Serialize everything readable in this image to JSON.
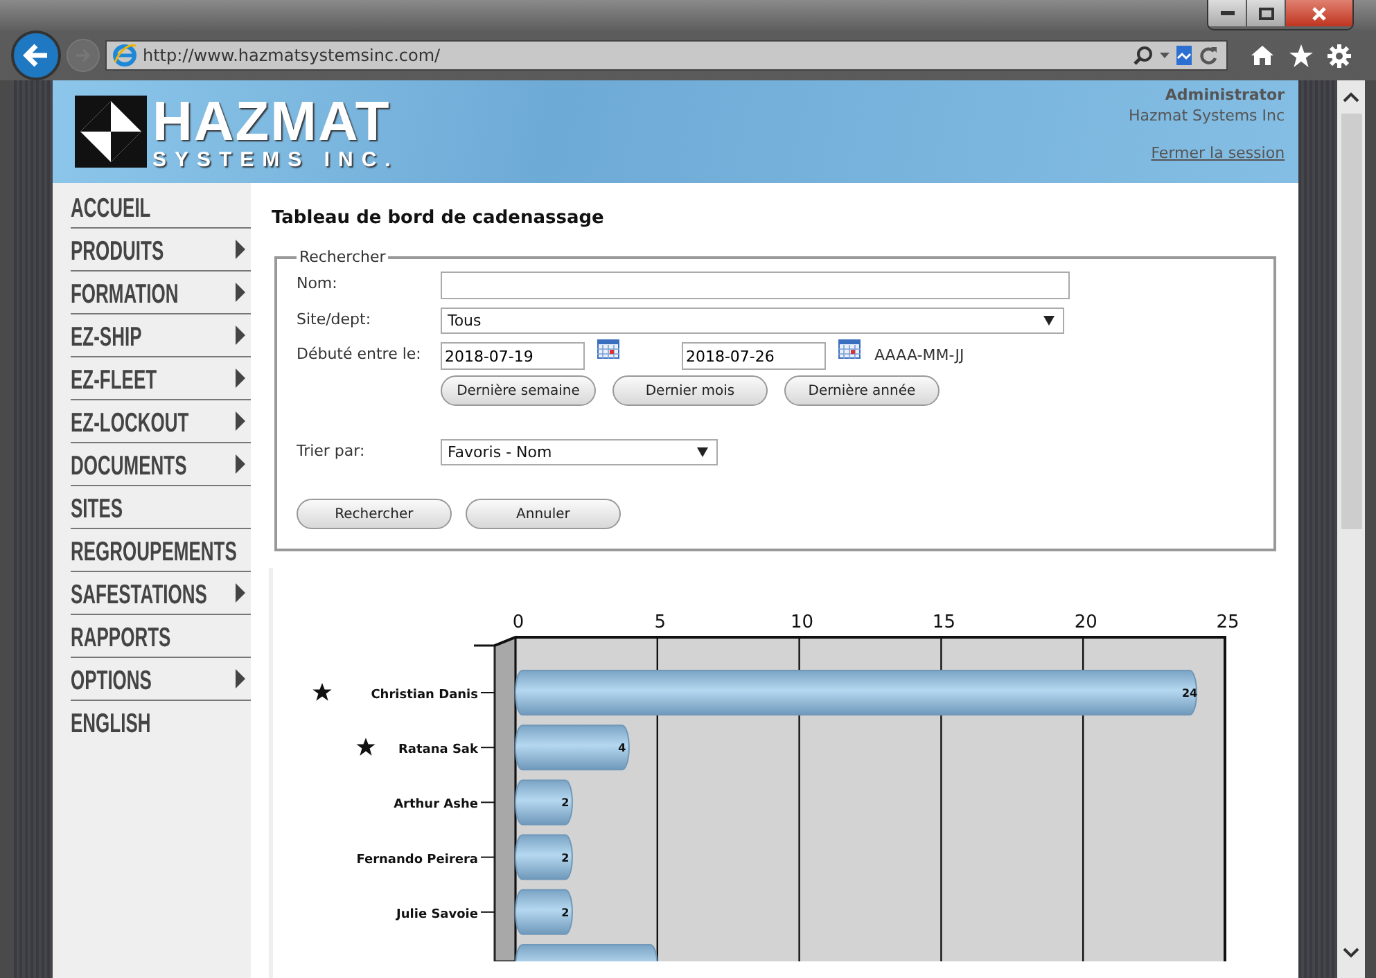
{
  "browser": {
    "url": "http://www.hazmatsystemsinc.com/"
  },
  "header": {
    "logo_top": "HAZMAT",
    "logo_bottom": "SYSTEMS INC.",
    "user": "Administrator",
    "company": "Hazmat Systems Inc",
    "logout": "Fermer la session"
  },
  "nav": [
    {
      "label": "ACCUEIL",
      "has_submenu": false
    },
    {
      "label": "PRODUITS",
      "has_submenu": true
    },
    {
      "label": "FORMATION",
      "has_submenu": true
    },
    {
      "label": "EZ-SHIP",
      "has_submenu": true
    },
    {
      "label": "EZ-FLEET",
      "has_submenu": true
    },
    {
      "label": "EZ-LOCKOUT",
      "has_submenu": true
    },
    {
      "label": "DOCUMENTS",
      "has_submenu": true
    },
    {
      "label": "SITES",
      "has_submenu": false
    },
    {
      "label": "REGROUPEMENTS",
      "has_submenu": false
    },
    {
      "label": "SAFESTATIONS",
      "has_submenu": true
    },
    {
      "label": "RAPPORTS",
      "has_submenu": false
    },
    {
      "label": "OPTIONS",
      "has_submenu": true
    },
    {
      "label": "ENGLISH",
      "has_submenu": false
    }
  ],
  "page_title": "Tableau de bord de cadenassage",
  "search_form": {
    "legend": "Rechercher",
    "name_label": "Nom:",
    "site_label": "Site/dept:",
    "site_value": "Tous",
    "date_label": "Débuté entre le:",
    "date_from": "2018-07-19",
    "date_to": "2018-07-26",
    "date_format": "AAAA-MM-JJ",
    "quick_ranges": [
      "Dernière semaine",
      "Dernier mois",
      "Dernière année"
    ],
    "sort_label": "Trier par:",
    "sort_value": "Favoris - Nom",
    "buttons": [
      "Rechercher",
      "Annuler"
    ]
  },
  "chart": {
    "favorites": [
      true,
      true,
      false,
      false,
      false
    ],
    "chart_data": {
      "type": "bar",
      "orientation": "horizontal",
      "categories": [
        "Christian Danis",
        "Ratana Sak",
        "Arthur Ashe",
        "Fernando Peirera",
        "Julie Savoie",
        null
      ],
      "values": [
        24,
        4,
        2,
        2,
        2,
        5
      ],
      "xlim": [
        0,
        25
      ],
      "xticks": [
        0,
        5,
        10,
        15,
        20,
        25
      ],
      "grid": true,
      "value_labels": [
        "24",
        "4",
        "2",
        "2",
        "2",
        null
      ]
    }
  }
}
